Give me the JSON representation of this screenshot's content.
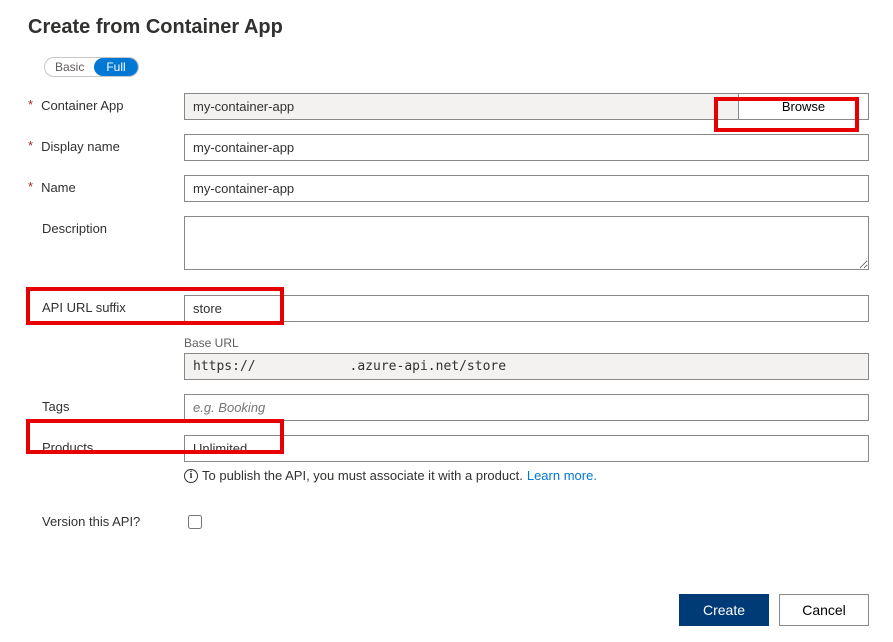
{
  "title": "Create from Container App",
  "toggle": {
    "basic": "Basic",
    "full": "Full"
  },
  "fields": {
    "containerApp": {
      "label": "Container App",
      "value": "my-container-app",
      "browse": "Browse"
    },
    "displayName": {
      "label": "Display name",
      "value": "my-container-app"
    },
    "name": {
      "label": "Name",
      "value": "my-container-app"
    },
    "description": {
      "label": "Description",
      "value": ""
    },
    "apiUrlSuffix": {
      "label": "API URL suffix",
      "value": "store"
    },
    "baseUrl": {
      "label": "Base URL",
      "value": "https://            .azure-api.net/store"
    },
    "tags": {
      "label": "Tags",
      "placeholder": "e.g. Booking"
    },
    "products": {
      "label": "Products",
      "value": "Unlimited"
    },
    "versionThisApi": {
      "label": "Version this API?"
    }
  },
  "hint": {
    "text": "To publish the API, you must associate it with a product. ",
    "link": "Learn more"
  },
  "buttons": {
    "create": "Create",
    "cancel": "Cancel"
  }
}
